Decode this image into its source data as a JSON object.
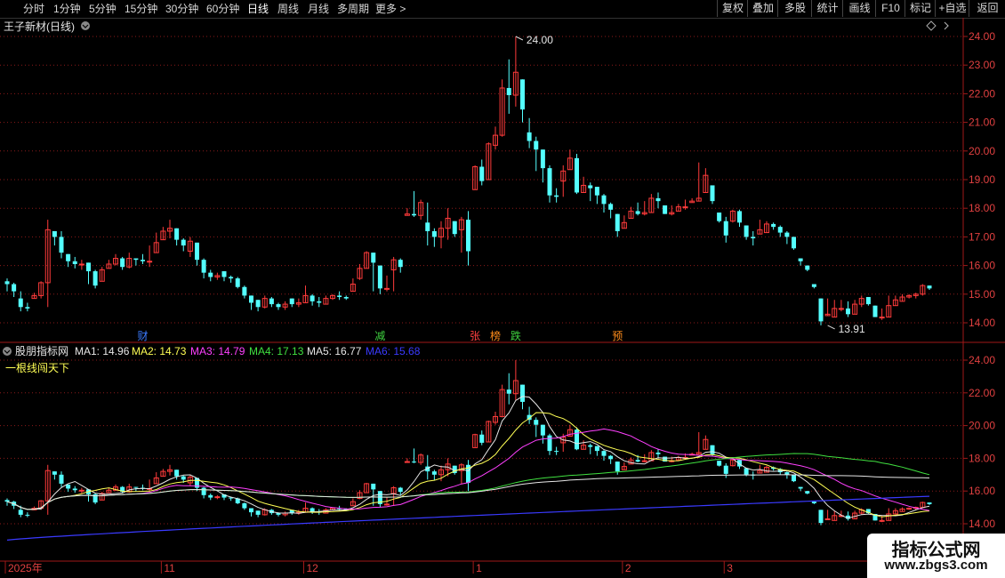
{
  "toolbar": {
    "periods": [
      "分时",
      "1分钟",
      "5分钟",
      "15分钟",
      "30分钟",
      "60分钟",
      "日线",
      "周线",
      "月线",
      "多周期",
      "更多 >"
    ],
    "active_period": "日线",
    "right_buttons": [
      "复权",
      "叠加",
      "多股",
      "统计",
      "画线",
      "F10",
      "标记",
      "+自选",
      "返回"
    ]
  },
  "main_panel": {
    "title": "王子新材(日线)",
    "price_ticks": [
      "24.00",
      "23.00",
      "22.00",
      "21.00",
      "20.00",
      "19.00",
      "18.00",
      "17.00",
      "16.00",
      "15.00",
      "14.00"
    ],
    "high_label": "24.00",
    "low_label": "13.91",
    "event_markers": [
      {
        "text": "财",
        "color": "#3b7bff",
        "idx": 20
      },
      {
        "text": "减",
        "color": "#3fd13f",
        "idx": 55
      },
      {
        "text": "张",
        "color": "#ff4040",
        "idx": 69
      },
      {
        "text": "榜",
        "color": "#ff8c1a",
        "idx": 72
      },
      {
        "text": "跌",
        "color": "#3fd13f",
        "idx": 75
      },
      {
        "text": "预",
        "color": "#ff8c1a",
        "idx": 90
      }
    ]
  },
  "indicator_panel": {
    "name": "股朋指标网",
    "ma_items": [
      {
        "label": "MA1: 14.96",
        "color": "#e6e6e6"
      },
      {
        "label": "MA2: 14.73",
        "color": "#ffff55"
      },
      {
        "label": "MA3: 14.79",
        "color": "#ff40ff"
      },
      {
        "label": "MA4: 17.13",
        "color": "#40e040"
      },
      {
        "label": "MA5: 16.77",
        "color": "#e6e6e6"
      },
      {
        "label": "MA6: 15.68",
        "color": "#3a3aff"
      }
    ],
    "subtitle": "一根线闯天下",
    "price_ticks": [
      "24.00",
      "22.00",
      "20.00",
      "18.00",
      "16.00",
      "14.00"
    ]
  },
  "date_axis": {
    "labels": [
      {
        "text": "2025年",
        "idx": 0
      },
      {
        "text": "11",
        "idx": 23
      },
      {
        "text": "12",
        "idx": 44
      },
      {
        "text": "1",
        "idx": 69
      },
      {
        "text": "2",
        "idx": 91
      },
      {
        "text": "3",
        "idx": 106
      }
    ]
  },
  "watermark": {
    "title": "指标公式网",
    "url": "www.zbgs3.com"
  },
  "colors": {
    "up": "#ff3b3b",
    "down": "#54ffff",
    "grid": "#8b1a1a",
    "axis": "#a01818"
  },
  "chart_data": {
    "type": "candlestick",
    "series": "王子新材 daily",
    "closes": [
      15.35,
      15.1,
      14.55,
      14.5,
      14.95,
      15.4,
      17.25,
      17.0,
      16.45,
      16.15,
      16.05,
      16.05,
      15.8,
      15.3,
      15.85,
      16.05,
      16.25,
      15.95,
      16.25,
      16.2,
      16.15,
      16.15,
      16.8,
      17.2,
      17.3,
      16.9,
      16.7,
      16.85,
      16.2,
      15.75,
      15.6,
      15.65,
      15.6,
      15.55,
      15.25,
      14.95,
      14.7,
      14.55,
      14.85,
      14.65,
      14.55,
      14.65,
      14.65,
      14.7,
      14.95,
      14.75,
      14.7,
      14.85,
      14.95,
      14.9,
      14.85,
      15.35,
      15.9,
      16.45,
      16.1,
      15.2,
      15.2,
      16.2,
      15.95,
      17.8,
      17.75,
      18.2,
      17.2,
      17.0,
      17.3,
      17.65,
      17.1,
      17.6,
      16.5,
      19.45,
      18.95,
      20.25,
      20.55,
      22.2,
      21.95,
      22.75,
      21.45,
      20.35,
      20.05,
      19.4,
      18.45,
      18.4,
      19.3,
      19.75,
      18.55,
      18.8,
      18.7,
      18.45,
      18.15,
      17.95,
      17.2,
      17.5,
      17.9,
      17.8,
      17.85,
      18.35,
      18.25,
      17.8,
      17.85,
      18.05,
      18.05,
      18.25,
      18.35,
      19.15,
      18.25,
      17.55,
      17.05,
      17.9,
      17.5,
      17.0,
      16.95,
      17.25,
      17.45,
      17.35,
      17.15,
      17.0,
      16.6,
      16.15,
      15.85,
      15.25,
      14.05,
      14.3,
      14.5,
      14.5,
      14.3,
      14.65,
      14.85,
      14.65,
      14.2,
      14.2,
      14.6,
      14.8,
      14.9,
      14.95,
      15.0,
      15.3,
      15.2
    ],
    "highs": [
      15.55,
      15.4,
      15.1,
      14.7,
      15.05,
      15.45,
      17.6,
      17.2,
      17.2,
      16.4,
      16.3,
      16.2,
      16.1,
      15.85,
      15.95,
      16.2,
      16.4,
      16.3,
      16.45,
      16.25,
      16.4,
      16.7,
      17.15,
      17.35,
      17.6,
      17.3,
      16.95,
      17.0,
      16.8,
      16.25,
      15.85,
      15.75,
      15.8,
      15.65,
      15.6,
      15.3,
      14.95,
      14.8,
      14.95,
      14.9,
      14.7,
      14.75,
      14.85,
      14.85,
      15.3,
      15.0,
      14.9,
      14.95,
      15.0,
      15.1,
      14.95,
      15.55,
      16.05,
      16.5,
      16.45,
      16.0,
      15.65,
      16.3,
      16.25,
      18.0,
      18.6,
      18.3,
      18.2,
      17.3,
      17.55,
      18.0,
      17.55,
      17.7,
      17.9,
      19.5,
      19.7,
      20.3,
      20.85,
      22.5,
      23.2,
      24.0,
      22.5,
      21.15,
      20.5,
      20.05,
      19.5,
      18.7,
      19.5,
      20.05,
      19.9,
      19.1,
      18.9,
      18.75,
      18.5,
      18.2,
      17.8,
      17.75,
      18.05,
      18.2,
      18.25,
      18.5,
      18.55,
      18.1,
      18.1,
      18.15,
      18.3,
      18.35,
      19.6,
      19.4,
      18.8,
      17.85,
      17.7,
      17.95,
      17.95,
      17.4,
      17.2,
      17.6,
      17.55,
      17.5,
      17.4,
      17.2,
      17.0,
      16.25,
      16.0,
      15.35,
      14.85,
      14.85,
      14.8,
      14.8,
      14.75,
      14.8,
      14.95,
      14.9,
      14.6,
      14.5,
      14.95,
      14.95,
      15.0,
      15.0,
      15.05,
      15.35,
      15.3
    ],
    "lows": [
      15.1,
      14.9,
      14.4,
      14.4,
      14.85,
      14.85,
      14.55,
      16.7,
      16.25,
      15.95,
      15.9,
      15.85,
      15.35,
      15.2,
      15.45,
      15.9,
      16.0,
      15.85,
      15.9,
      16.0,
      16.05,
      15.95,
      16.45,
      16.9,
      16.95,
      16.7,
      16.5,
      16.3,
      16.0,
      15.55,
      15.45,
      15.5,
      15.45,
      15.4,
      15.2,
      14.85,
      14.45,
      14.4,
      14.5,
      14.55,
      14.45,
      14.45,
      14.55,
      14.55,
      14.7,
      14.6,
      14.55,
      14.65,
      14.8,
      14.8,
      14.8,
      15.1,
      15.5,
      15.9,
      15.1,
      15.0,
      15.1,
      15.1,
      15.75,
      17.75,
      17.7,
      17.6,
      16.7,
      16.65,
      16.6,
      16.9,
      17.0,
      16.45,
      16.0,
      18.65,
      18.8,
      19.0,
      20.05,
      20.5,
      21.3,
      21.55,
      21.0,
      20.1,
      19.3,
      18.9,
      18.2,
      18.2,
      18.4,
      19.35,
      18.5,
      18.55,
      18.25,
      18.15,
      17.85,
      17.65,
      17.0,
      17.3,
      17.65,
      17.75,
      17.75,
      17.85,
      18.0,
      17.8,
      17.75,
      17.9,
      17.95,
      18.2,
      18.25,
      18.55,
      18.15,
      17.5,
      16.8,
      17.5,
      17.35,
      16.9,
      16.7,
      17.1,
      17.15,
      17.25,
      17.0,
      16.75,
      16.55,
      16.0,
      15.8,
      15.2,
      13.91,
      14.25,
      14.2,
      14.4,
      14.2,
      14.3,
      14.55,
      14.6,
      14.2,
      14.1,
      14.2,
      14.6,
      14.75,
      14.85,
      14.85,
      14.95,
      15.15
    ],
    "ma_lines": {
      "MA1_end": 14.96,
      "MA2_end": 14.73,
      "MA3_end": 14.79,
      "MA4_end": 17.13,
      "MA5_end": 16.77,
      "MA6_end": 15.68
    },
    "ylim_main": [
      13.7,
      24.1
    ],
    "ylim_indicator": [
      13.7,
      24.1
    ]
  }
}
